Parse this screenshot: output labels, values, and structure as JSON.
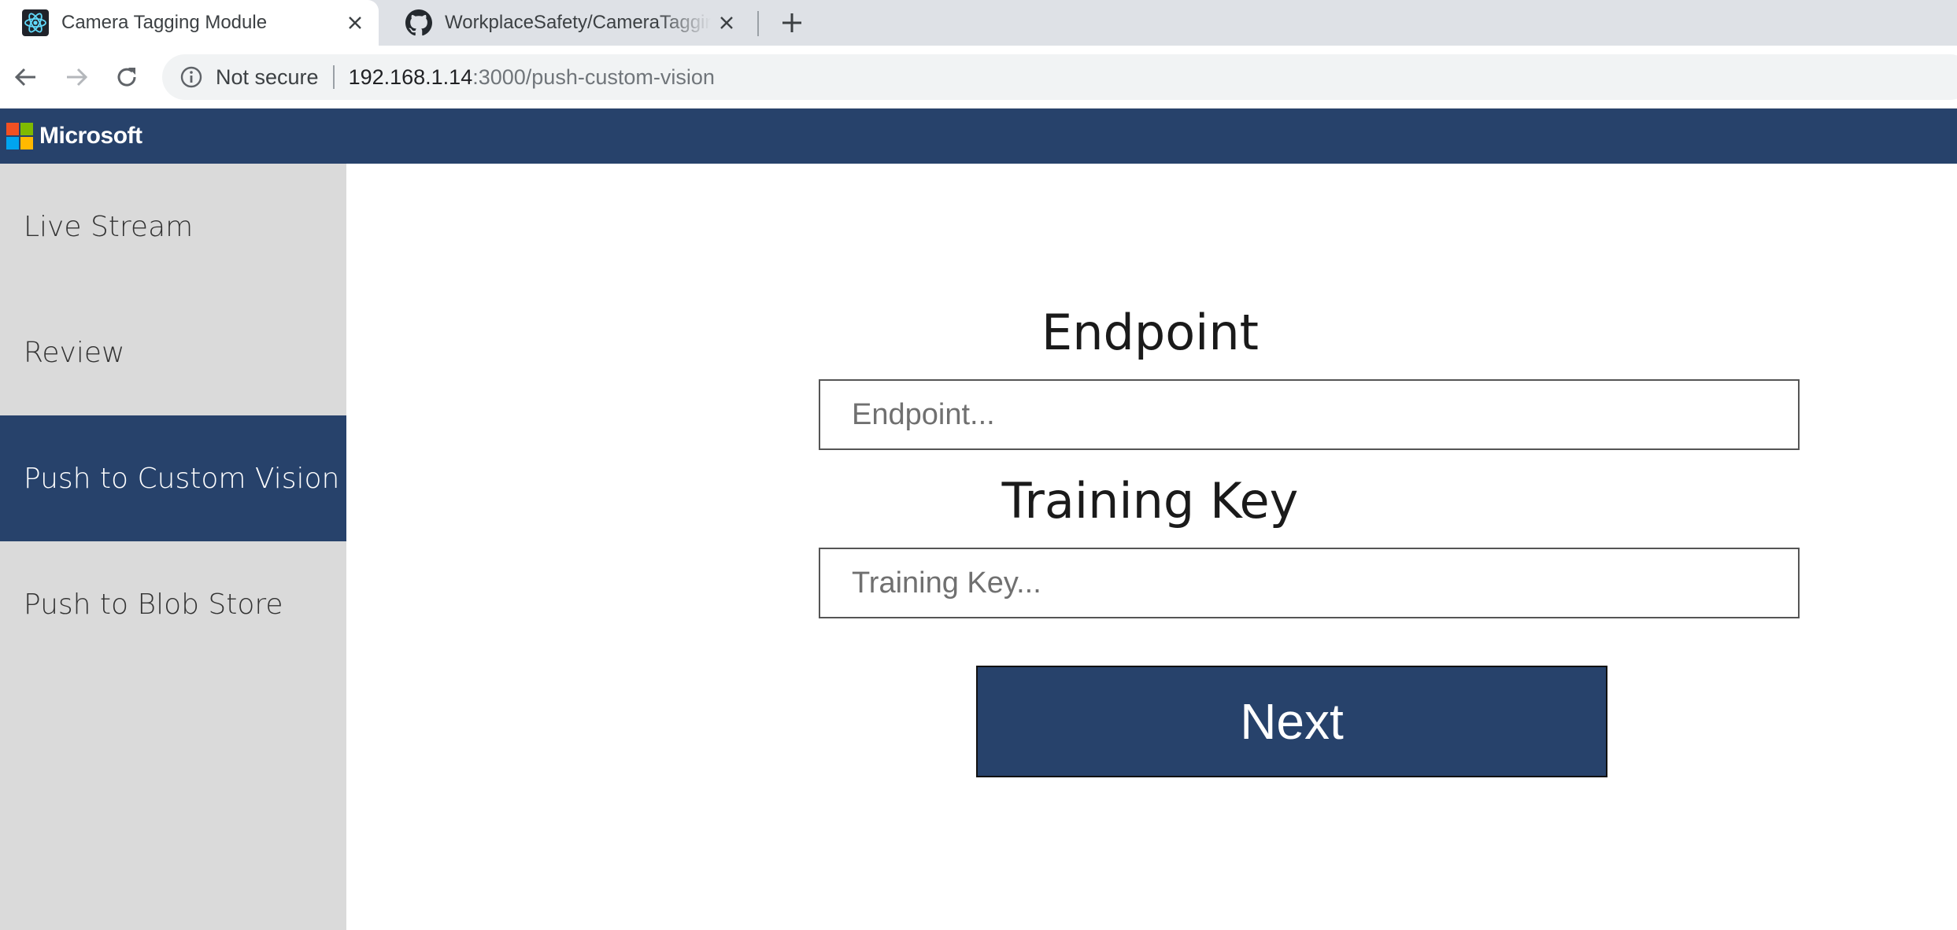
{
  "browser": {
    "tabs": [
      {
        "title": "Camera Tagging Module",
        "active": true,
        "icon": "react-icon"
      },
      {
        "title": "WorkplaceSafety/CameraTagging",
        "active": false,
        "icon": "github-icon"
      }
    ],
    "address": {
      "security_label": "Not secure",
      "host": "192.168.1.14",
      "path": ":3000/push-custom-vision"
    }
  },
  "header": {
    "brand": "Microsoft",
    "logo_colors": [
      "#f25022",
      "#7fba00",
      "#00a4ef",
      "#ffb900"
    ],
    "background": "#27426b"
  },
  "sidebar": {
    "items": [
      {
        "label": "Live Stream",
        "active": false
      },
      {
        "label": "Review",
        "active": false
      },
      {
        "label": "Push to Custom Vision",
        "active": true
      },
      {
        "label": "Push to Blob Store",
        "active": false
      }
    ]
  },
  "form": {
    "endpoint": {
      "label": "Endpoint",
      "placeholder": "Endpoint...",
      "value": ""
    },
    "training_key": {
      "label": "Training Key",
      "placeholder": "Training Key...",
      "value": ""
    },
    "next_label": "Next"
  }
}
